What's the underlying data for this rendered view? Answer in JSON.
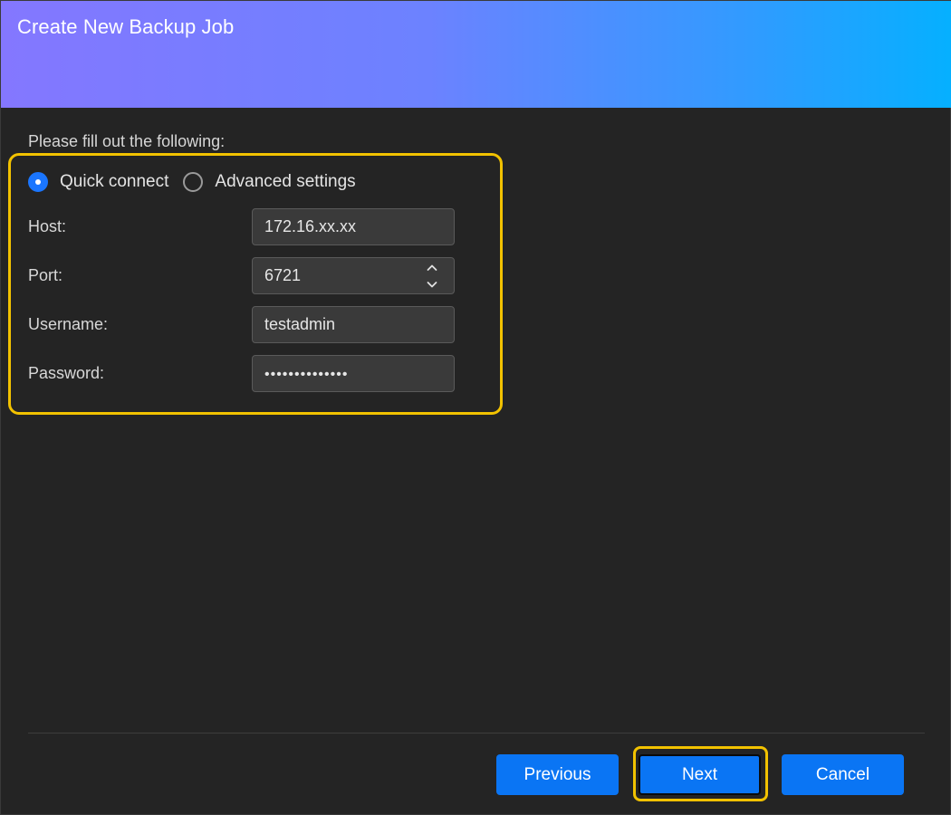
{
  "dialog": {
    "title": "Create New Backup Job"
  },
  "form": {
    "instruction": "Please fill out the following:",
    "connection_mode": {
      "options": [
        {
          "label": "Quick connect",
          "selected": true
        },
        {
          "label": "Advanced settings",
          "selected": false
        }
      ]
    },
    "fields": {
      "host": {
        "label": "Host:",
        "value": "172.16.xx.xx"
      },
      "port": {
        "label": "Port:",
        "value": "6721"
      },
      "username": {
        "label": "Username:",
        "value": "testadmin"
      },
      "password": {
        "label": "Password:",
        "value": "••••••••••••••"
      }
    }
  },
  "footer": {
    "previous_label": "Previous",
    "next_label": "Next",
    "cancel_label": "Cancel"
  },
  "colors": {
    "header_gradient_start": "#8477ff",
    "header_gradient_end": "#05b0ff",
    "primary_button": "#0a75f4",
    "highlight": "#f2c200",
    "background": "#242424"
  }
}
